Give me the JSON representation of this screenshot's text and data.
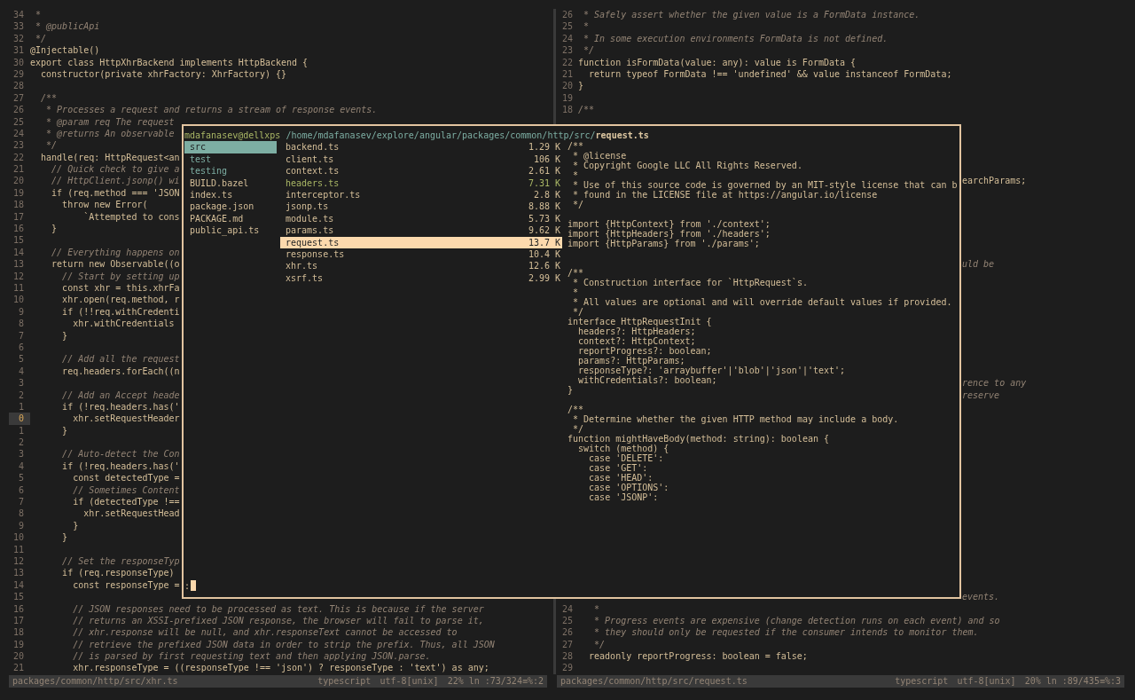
{
  "editor": {
    "rows": [
      {
        "left": {
          "num": "34",
          "text": " *",
          "kind": "comment",
          "current": false
        },
        "right": {
          "num": "26",
          "text": " * Safely assert whether the given value is a FormData instance.",
          "kind": "comment"
        }
      },
      {
        "left": {
          "num": "33",
          "text": " * @publicApi",
          "kind": "comment",
          "current": false
        },
        "right": {
          "num": "25",
          "text": " *",
          "kind": "comment"
        }
      },
      {
        "left": {
          "num": "32",
          "text": " */",
          "kind": "comment",
          "current": false
        },
        "right": {
          "num": "24",
          "text": " * In some execution environments FormData is not defined.",
          "kind": "comment"
        }
      },
      {
        "left": {
          "num": "31",
          "text": "@Injectable()",
          "kind": "code",
          "current": false
        },
        "right": {
          "num": "23",
          "text": " */",
          "kind": "comment"
        }
      },
      {
        "left": {
          "num": "30",
          "text": "export class HttpXhrBackend implements HttpBackend {",
          "kind": "code",
          "current": false
        },
        "right": {
          "num": "22",
          "text": "function isFormData(value: any): value is FormData {",
          "kind": "code"
        }
      },
      {
        "left": {
          "num": "29",
          "text": "  constructor(private xhrFactory: XhrFactory) {}",
          "kind": "code",
          "current": false
        },
        "right": {
          "num": "21",
          "text": "  return typeof FormData !== 'undefined' && value instanceof FormData;",
          "kind": "code"
        }
      },
      {
        "left": {
          "num": "28",
          "current": false
        },
        "right": {
          "num": "20",
          "text": "}",
          "kind": "code"
        }
      },
      {
        "left": {
          "num": "27",
          "text": "  /**",
          "kind": "comment",
          "current": false
        },
        "right": {
          "num": "19"
        }
      },
      {
        "left": {
          "num": "26",
          "text": "   * Processes a request and returns a stream of response events.",
          "kind": "comment",
          "current": false
        },
        "right": {
          "num": "18",
          "text": "/**",
          "kind": "comment"
        }
      },
      {
        "left": {
          "num": "25",
          "text": "   * @param req The request",
          "kind": "comment",
          "current": false
        }
      },
      {
        "left": {
          "num": "24",
          "text": "   * @returns An observable",
          "kind": "comment",
          "current": false
        }
      },
      {
        "left": {
          "num": "23",
          "text": "   */",
          "kind": "comment",
          "current": false
        }
      },
      {
        "left": {
          "num": "22",
          "text": "  handle(req: HttpRequest<an",
          "kind": "code",
          "current": false
        }
      },
      {
        "left": {
          "num": "21",
          "text": "    // Quick check to give a",
          "kind": "comment",
          "current": false
        }
      },
      {
        "left": {
          "num": "20",
          "text": "    // HttpClient.jsonp() wi",
          "kind": "comment",
          "current": false
        },
        "right": {
          "text": "earchParams;",
          "kind": "code"
        }
      },
      {
        "left": {
          "num": "19",
          "text": "    if (req.method === 'JSON",
          "kind": "code",
          "current": false
        }
      },
      {
        "left": {
          "num": "18",
          "text": "      throw new Error(",
          "kind": "code",
          "current": false
        }
      },
      {
        "left": {
          "num": "17",
          "text": "          `Attempted to cons",
          "kind": "code",
          "current": false
        }
      },
      {
        "left": {
          "num": "16",
          "text": "    }",
          "kind": "code",
          "current": false
        }
      },
      {
        "left": {
          "num": "15",
          "current": false
        }
      },
      {
        "left": {
          "num": "14",
          "text": "    // Everything happens on",
          "kind": "comment",
          "current": false
        }
      },
      {
        "left": {
          "num": "13",
          "text": "    return new Observable((o",
          "kind": "code",
          "current": false
        },
        "right": {
          "text": "uld be",
          "kind": "comment"
        }
      },
      {
        "left": {
          "num": "12",
          "text": "      // Start by setting up",
          "kind": "comment",
          "current": false
        }
      },
      {
        "left": {
          "num": "11",
          "text": "      const xhr = this.xhrFa",
          "kind": "code",
          "current": false
        }
      },
      {
        "left": {
          "num": "10",
          "text": "      xhr.open(req.method, r",
          "kind": "code",
          "current": false
        }
      },
      {
        "left": {
          "num": "9",
          "text": "      if (!!req.withCredenti",
          "kind": "code",
          "current": false
        }
      },
      {
        "left": {
          "num": "8",
          "text": "        xhr.withCredentials",
          "kind": "code",
          "current": false
        }
      },
      {
        "left": {
          "num": "7",
          "text": "      }",
          "kind": "code",
          "current": false
        }
      },
      {
        "left": {
          "num": "6",
          "current": false
        }
      },
      {
        "left": {
          "num": "5",
          "text": "      // Add all the request",
          "kind": "comment",
          "current": false
        }
      },
      {
        "left": {
          "num": "4",
          "text": "      req.headers.forEach((n",
          "kind": "code",
          "current": false
        }
      },
      {
        "left": {
          "num": "3",
          "current": false
        },
        "right": {
          "text": "rence to any",
          "kind": "comment"
        }
      },
      {
        "left": {
          "num": "2",
          "text": "      // Add an Accept heade",
          "kind": "comment",
          "current": false
        },
        "right": {
          "text": "reserve",
          "kind": "comment"
        }
      },
      {
        "left": {
          "num": "1",
          "text": "      if (!req.headers.has('",
          "kind": "code",
          "current": false
        }
      },
      {
        "left": {
          "num": "0",
          "text": "        xhr.setRequestHeader",
          "kind": "code",
          "current": true
        }
      },
      {
        "left": {
          "num": "1",
          "text": "      }",
          "kind": "code",
          "current": false
        }
      },
      {
        "left": {
          "num": "2",
          "current": false
        }
      },
      {
        "left": {
          "num": "3",
          "text": "      // Auto-detect the Con",
          "kind": "comment",
          "current": false
        }
      },
      {
        "left": {
          "num": "4",
          "text": "      if (!req.headers.has('",
          "kind": "code",
          "current": false
        }
      },
      {
        "left": {
          "num": "5",
          "text": "        const detectedType =",
          "kind": "code",
          "current": false
        }
      },
      {
        "left": {
          "num": "6",
          "text": "        // Sometimes Content",
          "kind": "comment",
          "current": false
        }
      },
      {
        "left": {
          "num": "7",
          "text": "        if (detectedType !==",
          "kind": "code",
          "current": false
        }
      },
      {
        "left": {
          "num": "8",
          "text": "          xhr.setRequestHead",
          "kind": "code",
          "current": false
        }
      },
      {
        "left": {
          "num": "9",
          "text": "        }",
          "kind": "code",
          "current": false
        }
      },
      {
        "left": {
          "num": "10",
          "text": "      }",
          "kind": "code",
          "current": false
        }
      },
      {
        "left": {
          "num": "11",
          "current": false
        }
      },
      {
        "left": {
          "num": "12",
          "text": "      // Set the responseTyp",
          "kind": "comment",
          "current": false
        }
      },
      {
        "left": {
          "num": "13",
          "text": "      if (req.responseType)",
          "kind": "code",
          "current": false
        }
      },
      {
        "left": {
          "num": "14",
          "text": "        const responseType =",
          "kind": "code",
          "current": false
        }
      },
      {
        "left": {
          "num": "15",
          "current": false
        },
        "right": {
          "text": "events.",
          "kind": "comment"
        }
      },
      {
        "left": {
          "num": "16",
          "text": "        // JSON responses need to be processed as text. This is because if the server",
          "kind": "comment",
          "current": false
        },
        "right": {
          "num": "24",
          "text": "   *",
          "kind": "comment"
        }
      },
      {
        "left": {
          "num": "17",
          "text": "        // returns an XSSI-prefixed JSON response, the browser will fail to parse it,",
          "kind": "comment",
          "current": false
        },
        "right": {
          "num": "25",
          "text": "   * Progress events are expensive (change detection runs on each event) and so",
          "kind": "comment"
        }
      },
      {
        "left": {
          "num": "18",
          "text": "        // xhr.response will be null, and xhr.responseText cannot be accessed to",
          "kind": "comment",
          "current": false
        },
        "right": {
          "num": "26",
          "text": "   * they should only be requested if the consumer intends to monitor them.",
          "kind": "comment"
        }
      },
      {
        "left": {
          "num": "19",
          "text": "        // retrieve the prefixed JSON data in order to strip the prefix. Thus, all JSON",
          "kind": "comment",
          "current": false
        },
        "right": {
          "num": "27",
          "text": "   */",
          "kind": "comment"
        }
      },
      {
        "left": {
          "num": "20",
          "text": "        // is parsed by first requesting text and then applying JSON.parse.",
          "kind": "comment",
          "current": false
        },
        "right": {
          "num": "28",
          "text": "  readonly reportProgress: boolean = false;",
          "kind": "code"
        }
      },
      {
        "left": {
          "num": "21",
          "text": "        xhr.responseType = ((responseType !== 'json') ? responseType : 'text') as any;",
          "kind": "code",
          "current": false
        },
        "right": {
          "num": "29"
        }
      }
    ]
  },
  "file_manager": {
    "user_host": "mdafanasev@dellxps",
    "path": "/home/mdafanasev/explore/angular/packages/common/http/src/",
    "file": "request.ts",
    "parent_items": [
      {
        "name": "src",
        "kind": "dir",
        "selected": true
      },
      {
        "name": "test",
        "kind": "dir",
        "selected": false
      },
      {
        "name": "testing",
        "kind": "dir",
        "selected": false
      },
      {
        "name": "BUILD.bazel",
        "kind": "file",
        "selected": false
      },
      {
        "name": "index.ts",
        "kind": "file",
        "selected": false
      },
      {
        "name": "package.json",
        "kind": "file",
        "selected": false
      },
      {
        "name": "PACKAGE.md",
        "kind": "file",
        "selected": false
      },
      {
        "name": "public_api.ts",
        "kind": "file",
        "selected": false
      }
    ],
    "files": [
      {
        "name": "backend.ts",
        "size": "1.29 K",
        "selected": false,
        "highlighted": false
      },
      {
        "name": "client.ts",
        "size": "106 K",
        "selected": false,
        "highlighted": false
      },
      {
        "name": "context.ts",
        "size": "2.61 K",
        "selected": false,
        "highlighted": false
      },
      {
        "name": "headers.ts",
        "size": "7.31 K",
        "selected": false,
        "highlighted": true
      },
      {
        "name": "interceptor.ts",
        "size": "2.8 K",
        "selected": false,
        "highlighted": false
      },
      {
        "name": "jsonp.ts",
        "size": "8.88 K",
        "selected": false,
        "highlighted": false
      },
      {
        "name": "module.ts",
        "size": "5.73 K",
        "selected": false,
        "highlighted": false
      },
      {
        "name": "params.ts",
        "size": "9.62 K",
        "selected": false,
        "highlighted": false
      },
      {
        "name": "request.ts",
        "size": "13.7 K",
        "selected": true,
        "highlighted": false
      },
      {
        "name": "response.ts",
        "size": "10.4 K",
        "selected": false,
        "highlighted": false
      },
      {
        "name": "xhr.ts",
        "size": "12.6 K",
        "selected": false,
        "highlighted": false
      },
      {
        "name": "xsrf.ts",
        "size": "2.99 K",
        "selected": false,
        "highlighted": false
      }
    ],
    "preview": "/**\n * @license\n * Copyright Google LLC All Rights Reserved.\n *\n * Use of this source code is governed by an MIT-style license that can b\n * found in the LICENSE file at https://angular.io/license\n */\n\nimport {HttpContext} from './context';\nimport {HttpHeaders} from './headers';\nimport {HttpParams} from './params';\n\n\n/**\n * Construction interface for `HttpRequest`s.\n *\n * All values are optional and will override default values if provided.\n */\ninterface HttpRequestInit {\n  headers?: HttpHeaders;\n  context?: HttpContext;\n  reportProgress?: boolean;\n  params?: HttpParams;\n  responseType?: 'arraybuffer'|'blob'|'json'|'text';\n  withCredentials?: boolean;\n}\n\n/**\n * Determine whether the given HTTP method may include a body.\n */\nfunction mightHaveBody(method: string): boolean {\n  switch (method) {\n    case 'DELETE':\n    case 'GET':\n    case 'HEAD':\n    case 'OPTIONS':\n    case 'JSONP':",
    "prompt": ":"
  },
  "status_bars": [
    {
      "path": "packages/common/http/src/xhr.ts",
      "filetype": "typescript",
      "encoding": "utf-8[unix]",
      "position": "22% ln :73/324≡%:2"
    },
    {
      "path": "packages/common/http/src/request.ts",
      "filetype": "typescript",
      "encoding": "utf-8[unix]",
      "position": "20% ln :89/435≡%:3"
    }
  ]
}
